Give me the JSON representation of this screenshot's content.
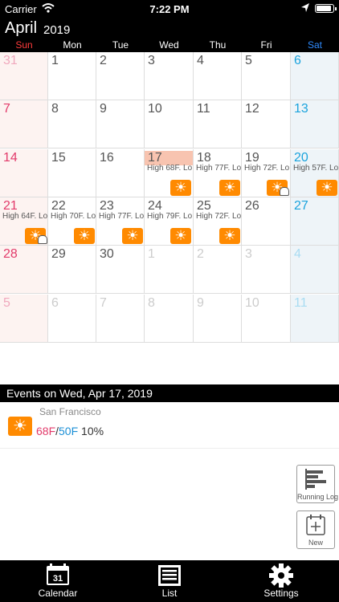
{
  "status_bar": {
    "carrier": "Carrier",
    "time": "7:22 PM"
  },
  "header": {
    "month": "April",
    "year": "2019"
  },
  "weekdays": [
    {
      "label": "Sun",
      "color": "#ff3b3b"
    },
    {
      "label": "Mon",
      "color": "#ffffff"
    },
    {
      "label": "Tue",
      "color": "#ffffff"
    },
    {
      "label": "Wed",
      "color": "#ffffff"
    },
    {
      "label": "Thu",
      "color": "#ffffff"
    },
    {
      "label": "Fri",
      "color": "#ffffff"
    },
    {
      "label": "Sat",
      "color": "#2f8cff"
    }
  ],
  "weeks": [
    [
      {
        "day": "31",
        "faded": true
      },
      {
        "day": "1"
      },
      {
        "day": "2"
      },
      {
        "day": "3"
      },
      {
        "day": "4"
      },
      {
        "day": "5"
      },
      {
        "day": "6"
      }
    ],
    [
      {
        "day": "7"
      },
      {
        "day": "8"
      },
      {
        "day": "9"
      },
      {
        "day": "10"
      },
      {
        "day": "11"
      },
      {
        "day": "12"
      },
      {
        "day": "13"
      }
    ],
    [
      {
        "day": "14"
      },
      {
        "day": "15"
      },
      {
        "day": "16"
      },
      {
        "day": "17",
        "today": true,
        "forecast": "High 68F. Lo",
        "icon": "sun"
      },
      {
        "day": "18",
        "forecast": "High 77F. Lo",
        "icon": "sun"
      },
      {
        "day": "19",
        "forecast": "High 72F. Lo",
        "icon": "sun-cloud"
      },
      {
        "day": "20",
        "forecast": "High 57F. Lo",
        "icon": "sun"
      }
    ],
    [
      {
        "day": "21",
        "forecast": "High 64F. Lo",
        "icon": "sun-cloud"
      },
      {
        "day": "22",
        "forecast": "High 70F. Lo",
        "icon": "sun"
      },
      {
        "day": "23",
        "forecast": "High 77F. Lo",
        "icon": "sun"
      },
      {
        "day": "24",
        "forecast": "High 79F. Lo",
        "icon": "sun"
      },
      {
        "day": "25",
        "forecast": "High 72F. Lo",
        "icon": "sun"
      },
      {
        "day": "26"
      },
      {
        "day": "27"
      }
    ],
    [
      {
        "day": "28"
      },
      {
        "day": "29"
      },
      {
        "day": "30"
      },
      {
        "day": "1",
        "faded": true
      },
      {
        "day": "2",
        "faded": true
      },
      {
        "day": "3",
        "faded": true
      },
      {
        "day": "4",
        "faded": true
      }
    ],
    [
      {
        "day": "5",
        "faded": true
      },
      {
        "day": "6",
        "faded": true
      },
      {
        "day": "7",
        "faded": true
      },
      {
        "day": "8",
        "faded": true
      },
      {
        "day": "9",
        "faded": true
      },
      {
        "day": "10",
        "faded": true
      },
      {
        "day": "11",
        "faded": true
      }
    ]
  ],
  "events": {
    "header": "Events on Wed, Apr 17, 2019",
    "items": [
      {
        "place": "San Francisco",
        "high": "68F",
        "sep": "/",
        "low": "50F",
        "precip": "10%",
        "icon": "sun"
      }
    ]
  },
  "side_buttons": {
    "running_log": "Running Log",
    "new": "New"
  },
  "tabs": [
    {
      "label": "Calendar",
      "icon": "calendar-icon"
    },
    {
      "label": "List",
      "icon": "list-icon"
    },
    {
      "label": "Settings",
      "icon": "gear-icon"
    }
  ],
  "colors": {
    "accent_orange": "#ff8a00",
    "today_highlight": "#f8c4b0",
    "sunday": "#e23a6a",
    "saturday": "#1aa3dd"
  }
}
